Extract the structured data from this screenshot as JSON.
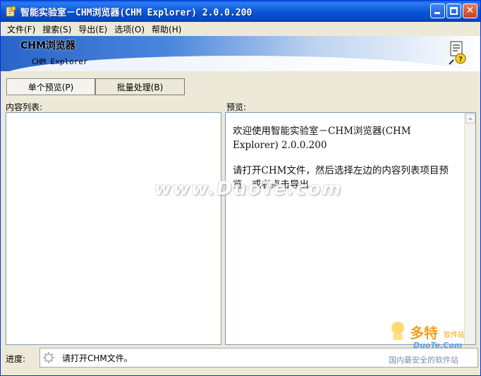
{
  "window": {
    "title": "智能实验室－CHM浏览器(CHM Explorer) 2.0.0.200"
  },
  "menu": [
    {
      "label": "文件(F)"
    },
    {
      "label": "搜索(S)"
    },
    {
      "label": "导出(E)"
    },
    {
      "label": "选项(O)"
    },
    {
      "label": "帮助(H)"
    }
  ],
  "banner": {
    "title": "CHM浏览器",
    "subtitle": "CHM Explorer",
    "icon": "help-agent-icon"
  },
  "tabs": [
    {
      "label": "单个预览(P)",
      "active": true
    },
    {
      "label": "批量处理(B)",
      "active": false
    }
  ],
  "content_list": {
    "label": "内容列表:",
    "items": []
  },
  "preview": {
    "label": "预览:",
    "paragraphs": [
      "欢迎使用智能实验室－CHM浏览器(CHM Explorer) 2.0.0.200",
      "请打开CHM文件，然后选择左边的内容列表项目预览，或者点击导出..."
    ]
  },
  "status": {
    "label": "进度:",
    "text": "请打开CHM文件。"
  },
  "watermarks": {
    "center": "www.DuoTe.com",
    "brand": "多特",
    "brand_sub": "软件站",
    "site": "DuoTe.Com",
    "slogan": "国内最安全的软件站"
  },
  "colors": {
    "titlebar": "#0a58d8",
    "close_button": "#c8411c",
    "window_bg": "#ece9d8"
  }
}
